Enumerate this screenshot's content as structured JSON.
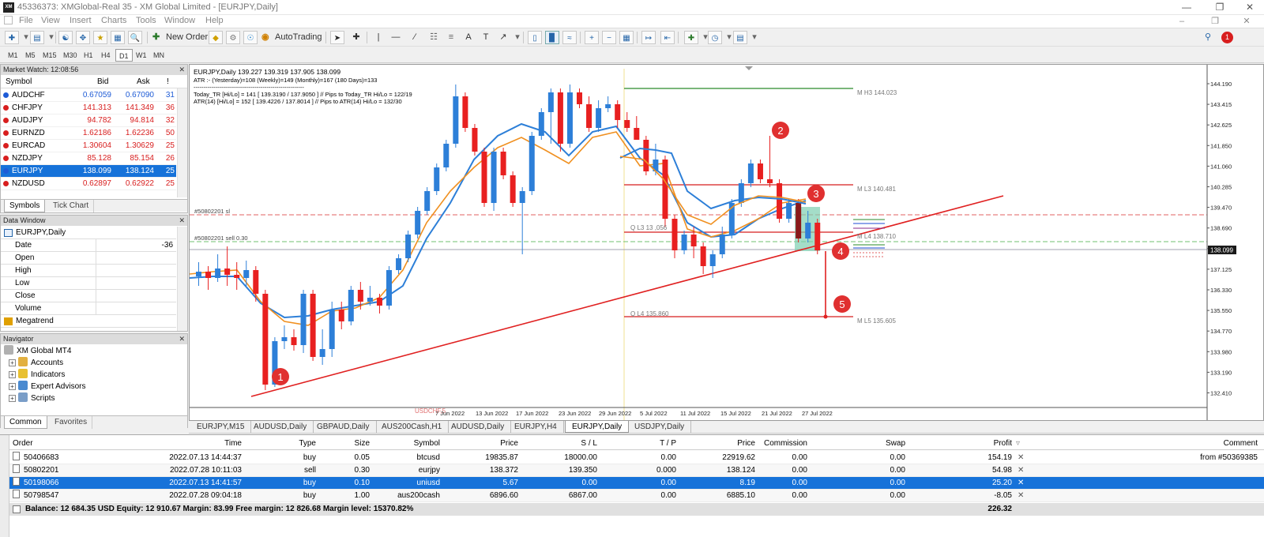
{
  "window": {
    "title": "45336373: XMGlobal-Real 35 - XM Global Limited - [EURJPY,Daily]",
    "logo": "XM"
  },
  "menu": [
    "File",
    "View",
    "Insert",
    "Charts",
    "Tools",
    "Window",
    "Help"
  ],
  "toolbar": {
    "new_order": "New Order",
    "autotrading": "AutoTrading",
    "notif_count": "1"
  },
  "timeframes": [
    "M1",
    "M5",
    "M15",
    "M30",
    "H1",
    "H4",
    "D1",
    "W1",
    "MN"
  ],
  "timeframe_active": "D1",
  "market_watch": {
    "title": "Market Watch: 12:08:56",
    "columns": [
      "Symbol",
      "Bid",
      "Ask",
      "!"
    ],
    "rows": [
      {
        "symbol": "AUDCHF",
        "bid": "0.67059",
        "ask": "0.67090",
        "spread": "31",
        "color": "blue"
      },
      {
        "symbol": "CHFJPY",
        "bid": "141.313",
        "ask": "141.349",
        "spread": "36",
        "color": "red"
      },
      {
        "symbol": "AUDJPY",
        "bid": "94.782",
        "ask": "94.814",
        "spread": "32",
        "color": "red"
      },
      {
        "symbol": "EURNZD",
        "bid": "1.62186",
        "ask": "1.62236",
        "spread": "50",
        "color": "red"
      },
      {
        "symbol": "EURCAD",
        "bid": "1.30604",
        "ask": "1.30629",
        "spread": "25",
        "color": "red"
      },
      {
        "symbol": "NZDJPY",
        "bid": "85.128",
        "ask": "85.154",
        "spread": "26",
        "color": "red"
      },
      {
        "symbol": "EURJPY",
        "bid": "138.099",
        "ask": "138.124",
        "spread": "25",
        "color": "blue",
        "selected": true
      },
      {
        "symbol": "NZDUSD",
        "bid": "0.62897",
        "ask": "0.62922",
        "spread": "25",
        "color": "red"
      }
    ],
    "tabs": [
      "Symbols",
      "Tick Chart"
    ]
  },
  "data_window": {
    "title": "Data Window",
    "symbol": "EURJPY,Daily",
    "rows": [
      {
        "key": "Date",
        "value": "-36"
      },
      {
        "key": "Open",
        "value": ""
      },
      {
        "key": "High",
        "value": ""
      },
      {
        "key": "Low",
        "value": ""
      },
      {
        "key": "Close",
        "value": ""
      },
      {
        "key": "Volume",
        "value": ""
      }
    ],
    "indicator": "Megatrend"
  },
  "navigator": {
    "title": "Navigator",
    "root": "XM Global MT4",
    "items": [
      "Accounts",
      "Indicators",
      "Expert Advisors",
      "Scripts"
    ],
    "tabs": [
      "Common",
      "Favorites"
    ]
  },
  "chart": {
    "header": "EURJPY,Daily  139.227 139.319 137.905 138.099",
    "atr_line": "ATR :- (Yesterday)=108      (Weekly)=149      (Monthly)=167      (180 Days)=133",
    "dash_line": "--------------------------------------------------------",
    "today_line": "Today_TR [Hi/Lo] = 141 [ 139.3190 / 137.9050 ]  // Pips to Today_TR Hi/Lo  = 122/19",
    "atr14_line": "ATR(14)     [Hi/Lo] = 152 [ 139.4226 / 137.8014 ]  // Pips to ATR(14) Hi/Lo      = 132/30",
    "sl_label": "#50802201 sl",
    "sell_label": "#50802201 sell 0.30",
    "h3_label": "M  H3 144.023",
    "l3_label": "M  L3 140.481",
    "q_l3_label": "Q  L3 13 ,056",
    "l4_label": "M  L4 138.710",
    "q_l4_label": "Q  L4 135.860",
    "l5_label": "M  L5 135.605",
    "watermark": "USDCHF,5",
    "price_box": "138.099",
    "price_labels": [
      "144.190",
      "143.415",
      "142.625",
      "141.850",
      "141.060",
      "140.285",
      "139.470",
      "138.690",
      "137.910",
      "137.125",
      "136.330",
      "135.550",
      "134.770",
      "133.980",
      "133.190",
      "132.410"
    ],
    "date_labels": [
      "7 Jun 2022",
      "13 Jun 2022",
      "17 Jun 2022",
      "23 Jun 2022",
      "29 Jun 2022",
      "5 Jul 2022",
      "11 Jul 2022",
      "15 Jul 2022",
      "21 Jul 2022",
      "27 Jul 2022"
    ],
    "markers": [
      "1",
      "2",
      "3",
      "4",
      "5"
    ]
  },
  "chart_tabs": [
    "EURJPY,M15",
    "AUDUSD,Daily",
    "GBPAUD,Daily",
    "AUS200Cash,H1",
    "AUDUSD,Daily",
    "EURJPY,H4",
    "EURJPY,Daily",
    "USDJPY,Daily"
  ],
  "chart_tab_active": "EURJPY,Daily",
  "trade": {
    "columns": [
      "Order",
      "Time",
      "Type",
      "Size",
      "Symbol",
      "Price",
      "S / L",
      "T / P",
      "Price",
      "Commission",
      "Swap",
      "Profit",
      "Comment"
    ],
    "rows": [
      {
        "order": "50406683",
        "time": "2022.07.13 14:44:37",
        "type": "buy",
        "size": "0.05",
        "symbol": "btcusd",
        "price": "19835.87",
        "sl": "18000.00",
        "tp": "0.00",
        "price2": "22919.62",
        "commission": "0.00",
        "swap": "0.00",
        "profit": "154.19",
        "comment": "from #50369385"
      },
      {
        "order": "50802201",
        "time": "2022.07.28 10:11:03",
        "type": "sell",
        "size": "0.30",
        "symbol": "eurjpy",
        "price": "138.372",
        "sl": "139.350",
        "tp": "0.000",
        "price2": "138.124",
        "commission": "0.00",
        "swap": "0.00",
        "profit": "54.98",
        "comment": ""
      },
      {
        "order": "50198066",
        "time": "2022.07.13 14:41:57",
        "type": "buy",
        "size": "0.10",
        "symbol": "uniusd",
        "price": "5.67",
        "sl": "0.00",
        "tp": "0.00",
        "price2": "8.19",
        "commission": "0.00",
        "swap": "0.00",
        "profit": "25.20",
        "comment": "",
        "selected": true
      },
      {
        "order": "50798547",
        "time": "2022.07.28 09:04:18",
        "type": "buy",
        "size": "1.00",
        "symbol": "aus200cash",
        "price": "6896.60",
        "sl": "6867.00",
        "tp": "0.00",
        "price2": "6885.10",
        "commission": "0.00",
        "swap": "0.00",
        "profit": "-8.05",
        "comment": ""
      }
    ],
    "balance_line": "Balance: 12 684.35 USD  Equity: 12 910.67  Margin: 83.99  Free margin: 12 826.68  Margin level: 15370.82%",
    "total_profit": "226.32"
  }
}
